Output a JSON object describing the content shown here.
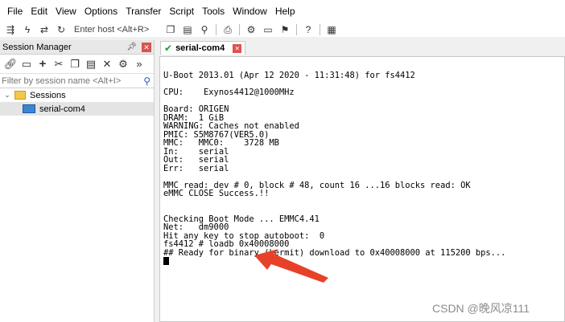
{
  "menu": {
    "items": [
      "File",
      "Edit",
      "View",
      "Options",
      "Transfer",
      "Script",
      "Tools",
      "Window",
      "Help"
    ]
  },
  "toolbar": {
    "host_placeholder": "Enter host <Alt+R>"
  },
  "session_manager": {
    "title": "Session Manager",
    "filter_placeholder": "Filter by session name <Alt+I>",
    "tree": {
      "folder": "Sessions",
      "session": "serial-com4"
    }
  },
  "tab": {
    "label": "serial-com4"
  },
  "terminal": {
    "lines": [
      "U-Boot 2013.01 (Apr 12 2020 - 11:31:48) for fs4412",
      "",
      "CPU:    Exynos4412@1000MHz",
      "",
      "Board: ORIGEN",
      "DRAM:  1 GiB",
      "WARNING: Caches not enabled",
      "PMIC: S5M8767(VER5.0)",
      "MMC:   MMC0:    3728 MB",
      "In:    serial",
      "Out:   serial",
      "Err:   serial",
      "",
      "MMC read: dev # 0, block # 48, count 16 ...16 blocks read: OK",
      "eMMC CLOSE Success.!!",
      "",
      "",
      "Checking Boot Mode ... EMMC4.41",
      "Net:   dm9000",
      "Hit any key to stop autoboot:  0",
      "fs4412 # loadb 0x40008000",
      "## Ready for binary (kermit) download to 0x40008000 at 115200 bps..."
    ]
  },
  "annotation": {
    "arrow_color": "#e8412a"
  },
  "watermark": {
    "text": "CSDN @晚风凉111"
  },
  "icons": {
    "toolbar": [
      "connect-icon",
      "quick-connect-icon",
      "reconnect-icon",
      "connect-in-tab-icon",
      "copy-icon",
      "paste-icon",
      "find-icon",
      "print-icon",
      "settings-icon",
      "session-options-icon",
      "keymap-icon",
      "help-icon",
      "log-icon"
    ],
    "session_tools": [
      "link-icon",
      "tab-icon",
      "add-icon",
      "cut-icon",
      "copy-icon",
      "paste-icon",
      "delete-icon",
      "properties-icon",
      "more-icon"
    ]
  }
}
